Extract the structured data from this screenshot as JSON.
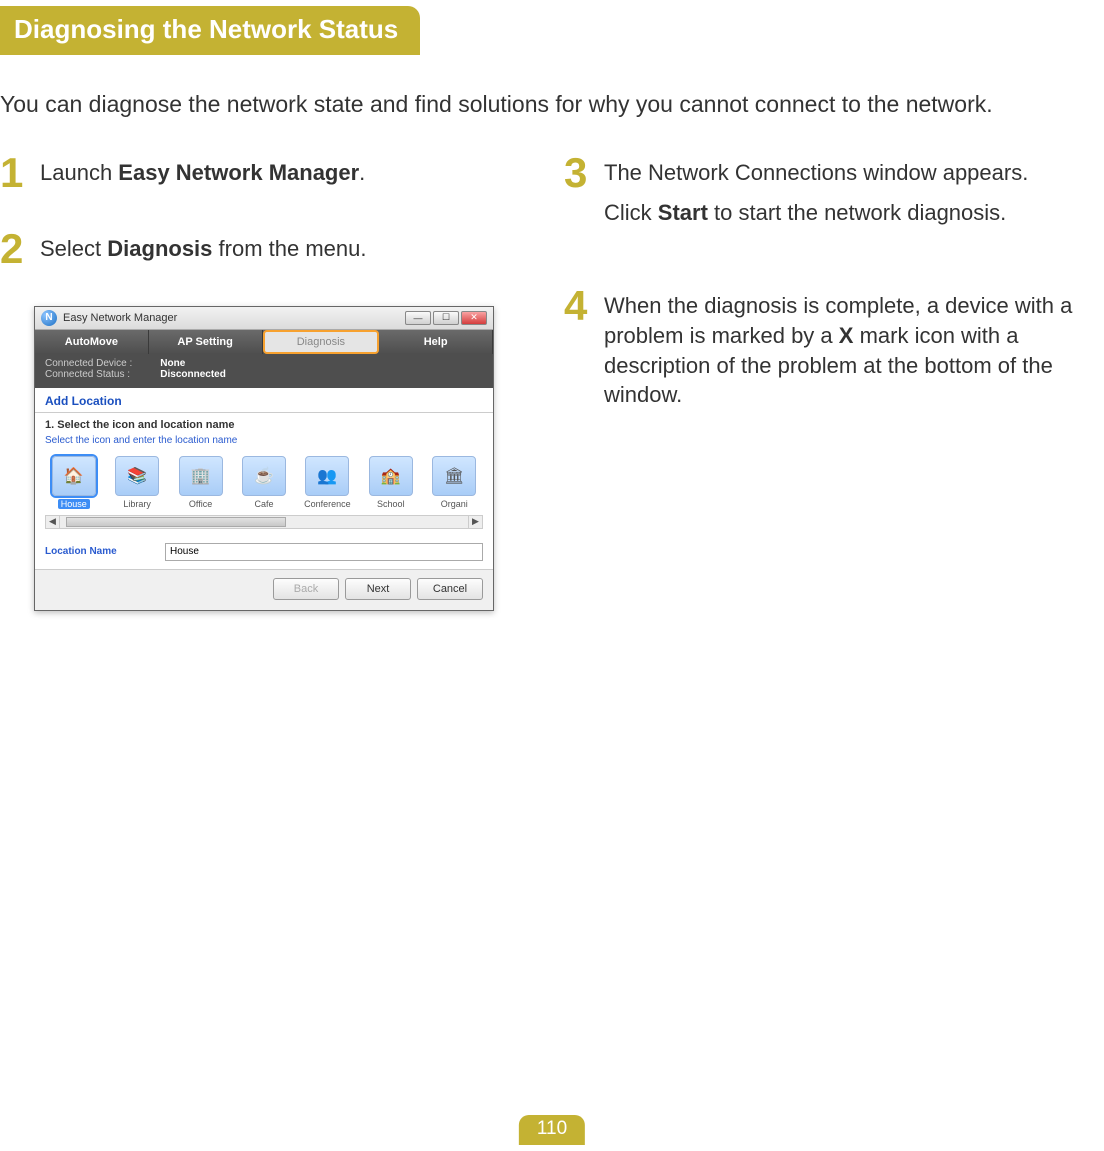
{
  "heading": "Diagnosing the Network Status",
  "intro": "You can diagnose the network state and find solutions for why you cannot connect to the network.",
  "steps": {
    "s1": {
      "num": "1",
      "pre": "Launch ",
      "bold": "Easy Network Manager",
      "post": "."
    },
    "s2": {
      "num": "2",
      "pre": "Select ",
      "bold": "Diagnosis",
      "post": " from the menu."
    },
    "s3": {
      "num": "3",
      "line1": "The Network Connections window appears.",
      "line2_pre": "Click ",
      "line2_bold": "Start",
      "line2_post": " to start the network diagnosis."
    },
    "s4": {
      "num": "4",
      "pre": "When the diagnosis is complete, a device with a problem is marked by a ",
      "bold": "X",
      "post": " mark icon with a description of the problem at the bottom of the window."
    }
  },
  "app": {
    "title": "Easy Network Manager",
    "tabs": {
      "automove": "AutoMove",
      "apsetting": "AP Setting",
      "diagnosis": "Diagnosis",
      "help": "Help"
    },
    "status": {
      "device_label": "Connected Device :",
      "device_value": "None",
      "status_label": "Connected Status :",
      "status_value": "Disconnected"
    },
    "add_location": "Add Location",
    "section_title": "1. Select the icon and location name",
    "section_sub": "Select the icon and enter the location name",
    "locations": [
      "House",
      "Library",
      "Office",
      "Cafe",
      "Conference",
      "School",
      "Organi"
    ],
    "loc_name_label": "Location Name",
    "loc_name_value": "House",
    "buttons": {
      "back": "Back",
      "next": "Next",
      "cancel": "Cancel"
    }
  },
  "page_number": "110"
}
